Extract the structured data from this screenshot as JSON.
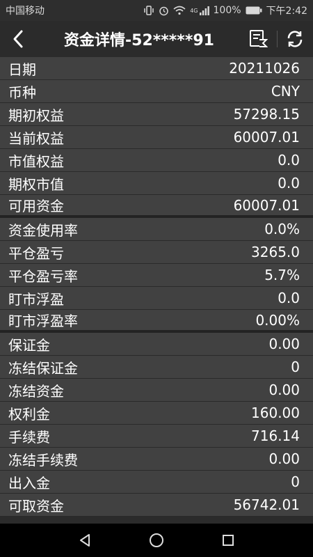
{
  "status_bar": {
    "carrier": "中国移动",
    "battery": "100%",
    "time": "下午2:42",
    "signal_label": "4G"
  },
  "header": {
    "title": "资金详情-52*****91",
    "back_icon": "back-arrow-icon",
    "statement_icon": "statement-icon",
    "refresh_icon": "refresh-icon"
  },
  "rows": [
    {
      "label": "日期",
      "value": "20211026"
    },
    {
      "label": "币种",
      "value": "CNY"
    },
    {
      "label": "期初权益",
      "value": "57298.15"
    },
    {
      "label": "当前权益",
      "value": "60007.01"
    },
    {
      "label": "市值权益",
      "value": "0.0"
    },
    {
      "label": "期权市值",
      "value": "0.0"
    },
    {
      "label": "可用资金",
      "value": "60007.01"
    },
    {
      "label": "资金使用率",
      "value": "0.0%"
    },
    {
      "label": "平仓盈亏",
      "value": "3265.0"
    },
    {
      "label": "平仓盈亏率",
      "value": "5.7%"
    },
    {
      "label": "盯市浮盈",
      "value": "0.0"
    },
    {
      "label": "盯市浮盈率",
      "value": "0.00%"
    },
    {
      "label": "保证金",
      "value": "0.00"
    },
    {
      "label": "冻结保证金",
      "value": "0"
    },
    {
      "label": "冻结资金",
      "value": "0.00"
    },
    {
      "label": "权利金",
      "value": "160.00"
    },
    {
      "label": "手续费",
      "value": "716.14"
    },
    {
      "label": "冻结手续费",
      "value": "0.00"
    },
    {
      "label": "出入金",
      "value": "0"
    },
    {
      "label": "可取资金",
      "value": "56742.01"
    }
  ],
  "nav_bar": {
    "back_icon": "triangle-back-icon",
    "home_icon": "circle-home-icon",
    "recents_icon": "square-recents-icon"
  }
}
